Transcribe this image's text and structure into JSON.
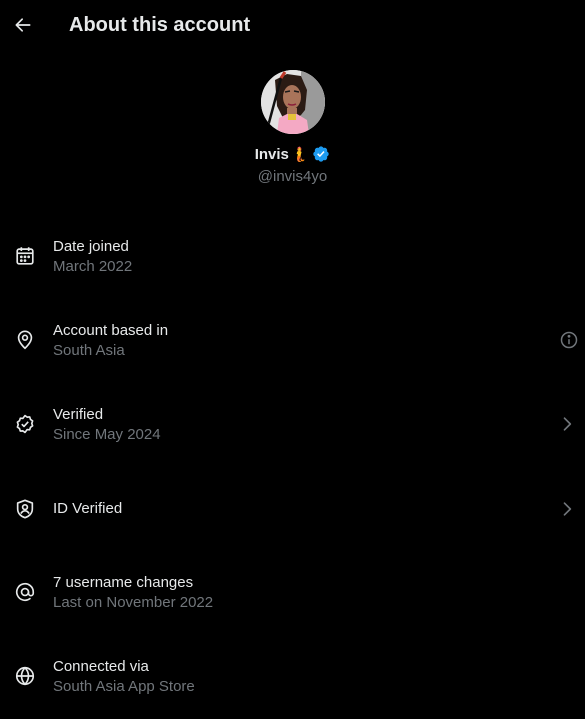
{
  "header": {
    "title": "About this account",
    "back_icon": "arrow-left-icon"
  },
  "profile": {
    "display_name": "Invis",
    "name_emoji": "🧜",
    "handle": "@invis4yo",
    "verified_color": "#1d9bf0"
  },
  "rows": [
    {
      "icon": "calendar-icon",
      "label": "Date joined",
      "sub": "March 2022",
      "trailing": ""
    },
    {
      "icon": "location-pin-icon",
      "label": "Account based in",
      "sub": "South Asia",
      "trailing": "info-icon"
    },
    {
      "icon": "verified-check-icon",
      "label": "Verified",
      "sub": "Since May 2024",
      "trailing": "chevron-right-icon"
    },
    {
      "icon": "shield-user-icon",
      "label": "ID Verified",
      "sub": "",
      "trailing": "chevron-right-icon"
    },
    {
      "icon": "at-sign-icon",
      "label": "7 username changes",
      "sub": "Last on November 2022",
      "trailing": ""
    },
    {
      "icon": "globe-icon",
      "label": "Connected via",
      "sub": "South Asia App Store",
      "trailing": ""
    }
  ],
  "colors": {
    "background": "#000000",
    "primary_text": "#e7e9ea",
    "secondary_text": "#71767b",
    "accent": "#1d9bf0"
  }
}
